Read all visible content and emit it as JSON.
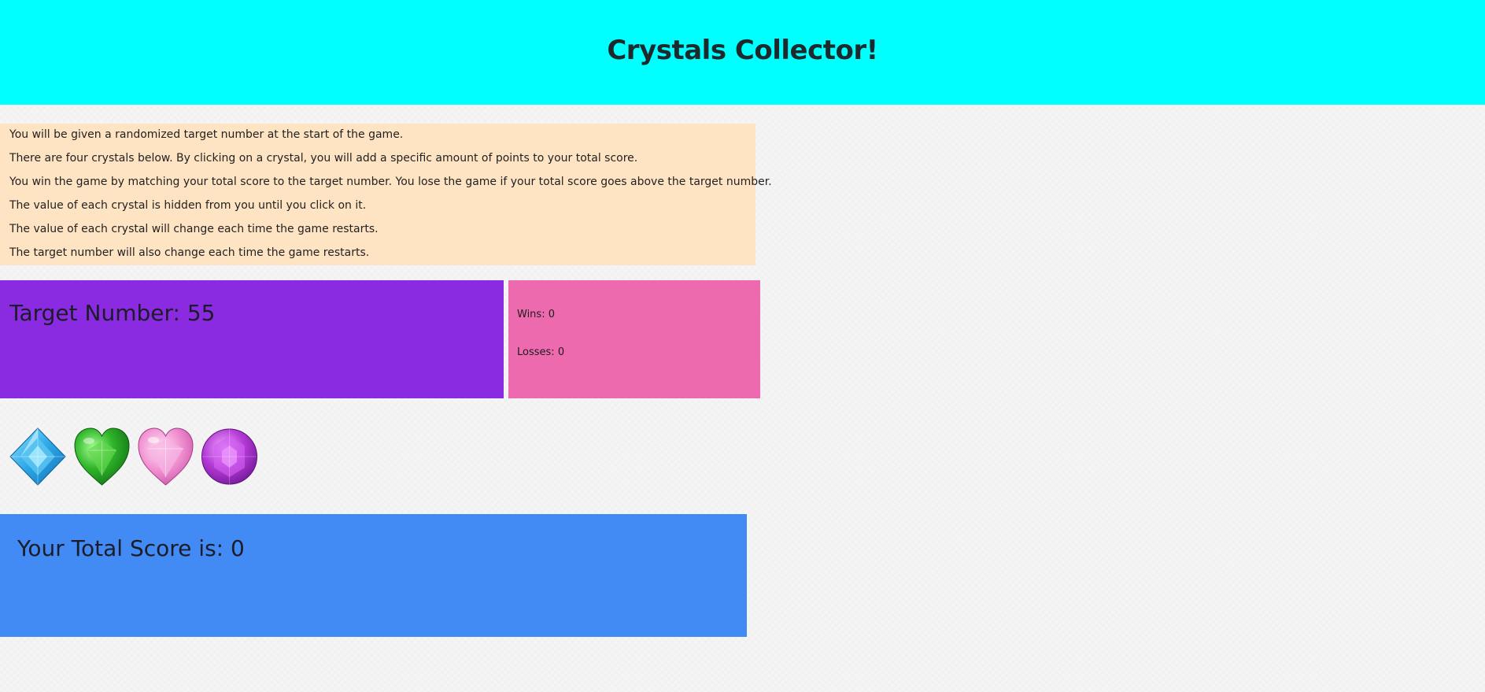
{
  "header": {
    "title": "Crystals Collector!"
  },
  "instructions": [
    "You will be given a randomized target number at the start of the game.",
    "There are four crystals below. By clicking on a crystal, you will add a specific amount of points to your total score.",
    "You win the game by matching your total score to the target number. You lose the game if your total score goes above the target number.",
    "The value of each crystal is hidden from you until you click on it.",
    "The value of each crystal will change each time the game restarts.",
    "The target number will also change each time the game restarts."
  ],
  "target": {
    "label": "Target Number:",
    "value": "55"
  },
  "record": {
    "wins_label": "Wins:",
    "wins": "0",
    "losses_label": "Losses:",
    "losses": "0"
  },
  "crystals": [
    {
      "name": "blue-diamond-crystal",
      "color": "#2aa7e6"
    },
    {
      "name": "green-heart-crystal",
      "color": "#2fb52a"
    },
    {
      "name": "pink-heart-crystal",
      "color": "#f08fd0"
    },
    {
      "name": "purple-round-crystal",
      "color": "#b33ad6"
    }
  ],
  "score": {
    "label": "Your Total Score is:",
    "value": "0"
  },
  "colors": {
    "header": "#00ffff",
    "instructions": "#ffe4c4",
    "target": "#8a2be2",
    "record": "#ee6aaf",
    "score": "#428bf5"
  }
}
